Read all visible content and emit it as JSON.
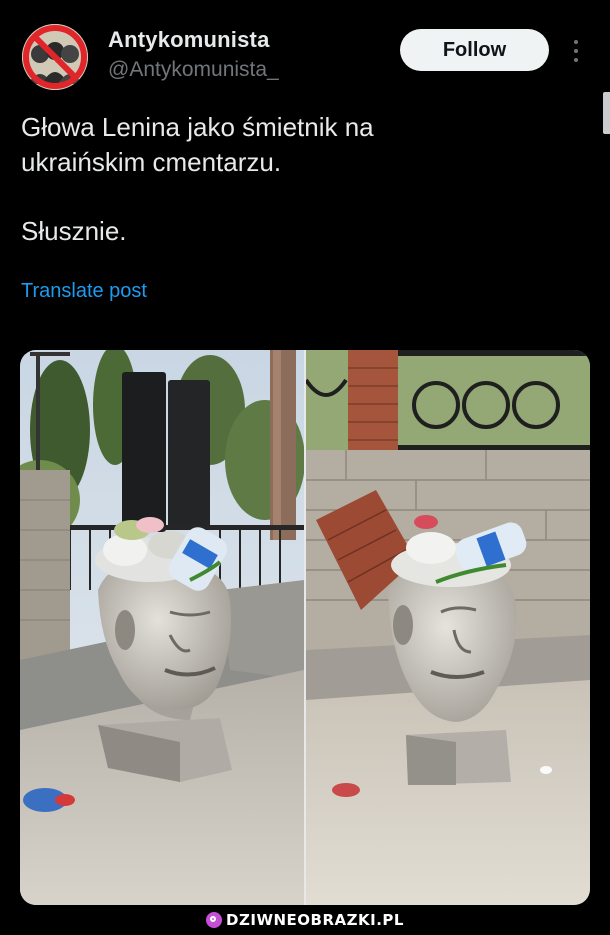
{
  "header": {
    "display_name": "Antykomunista",
    "handle": "@Antykomunista_",
    "follow_label": "Follow",
    "avatar_icon": "crossed-out-communist-portraits-avatar"
  },
  "tweet": {
    "text": "Głowa Lenina jako śmietnik na\nukraińskim cmentarzu.\n\nSłusznie.",
    "translate_label": "Translate post"
  },
  "media": {
    "photos": [
      "photo-1",
      "photo-2"
    ]
  },
  "watermark": {
    "text": "DZIWNEOBRAZKI.PL",
    "icon": "magnifier-icon"
  },
  "colors": {
    "background": "#000000",
    "text_primary": "#e7e9ea",
    "text_secondary": "#71767b",
    "link": "#1d9bf0",
    "follow_bg": "#eff3f4",
    "watermark_accent": "#c64fd8"
  }
}
